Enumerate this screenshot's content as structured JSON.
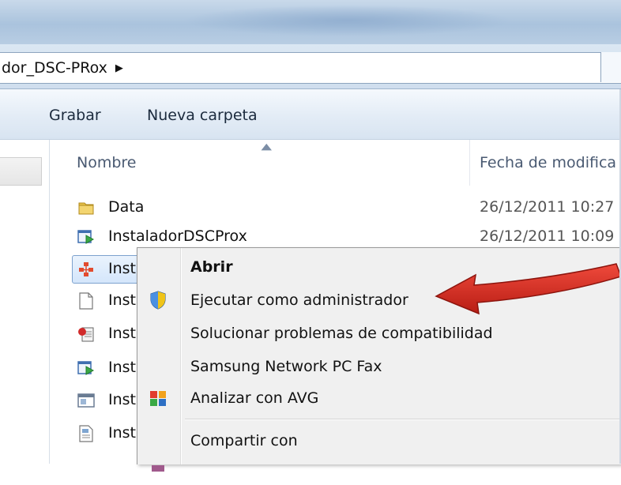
{
  "address": {
    "crumb": "dor_DSC-PRox",
    "crumb_arrow": "▶"
  },
  "toolbar": {
    "burn_label": "Grabar",
    "new_folder_label": "Nueva carpeta"
  },
  "columns": {
    "name": "Nombre",
    "date": "Fecha de modifica"
  },
  "files": [
    {
      "icon": "folder-icon",
      "name": "Data",
      "date": "26/12/2011 10:27"
    },
    {
      "icon": "installer-icon",
      "name": "InstaladorDSCProx",
      "date": "26/12/2011 10:09"
    },
    {
      "icon": "app-icon",
      "name": "Inst",
      "date": ""
    },
    {
      "icon": "document-icon",
      "name": "Inst",
      "date": ""
    },
    {
      "icon": "help-icon",
      "name": "Inst",
      "date": ""
    },
    {
      "icon": "installer-icon",
      "name": "Inst",
      "date": ""
    },
    {
      "icon": "window-icon",
      "name": "Inst",
      "date": ""
    },
    {
      "icon": "config-icon",
      "name": "Inst",
      "date": ""
    }
  ],
  "context_menu": {
    "open": "Abrir",
    "run_as_admin": "Ejecutar como administrador",
    "troubleshoot": "Solucionar problemas de compatibilidad",
    "fax": "Samsung Network PC Fax",
    "avg": "Analizar con AVG",
    "share": "Compartir con"
  },
  "colors": {
    "arrow": "#d42a20",
    "selection": "#d4e6fb",
    "titlebar": "#aac3dd"
  }
}
